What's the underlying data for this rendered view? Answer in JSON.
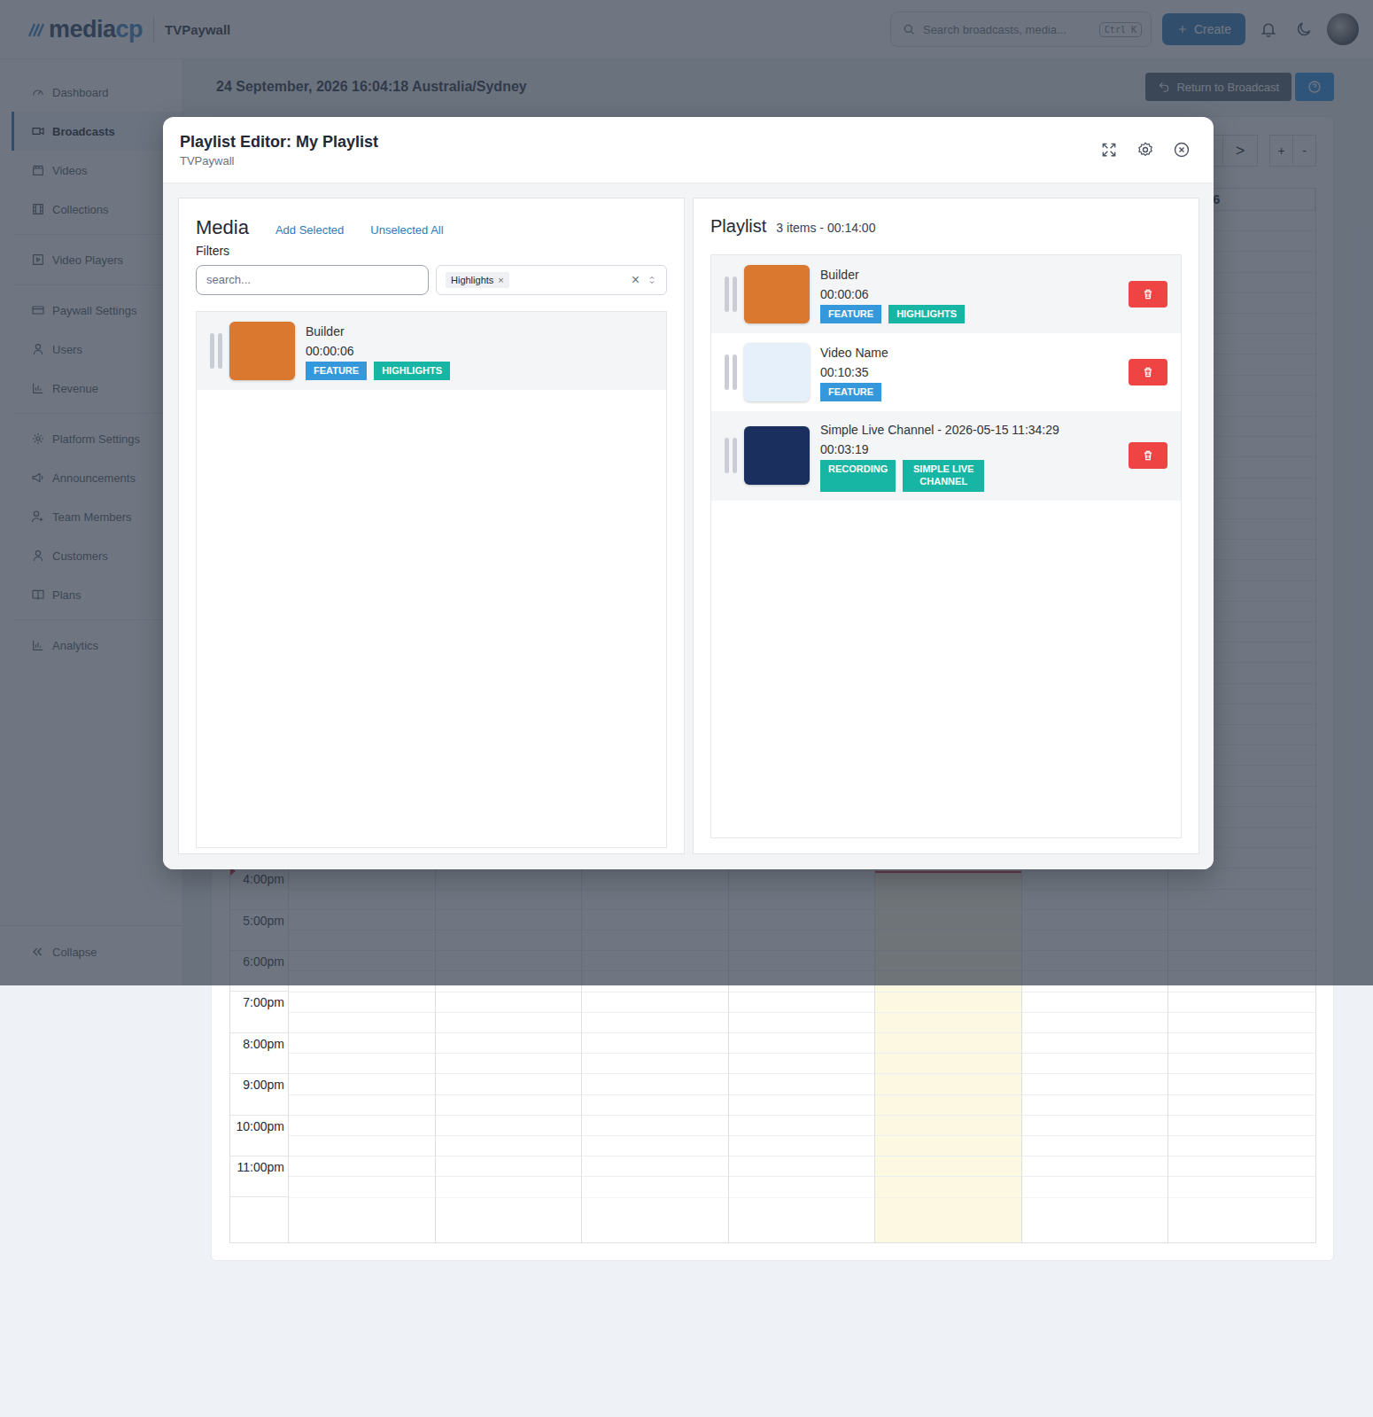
{
  "topbar": {
    "logo": [
      "media",
      "cp"
    ],
    "workspace": "TVPaywall",
    "search": {
      "placeholder": "Search broadcasts, media...",
      "shortcut": "Ctrl K"
    },
    "create_button": "Create"
  },
  "sidebar": {
    "groups": [
      [
        {
          "label": "Dashboard",
          "selected": false
        },
        {
          "label": "Broadcasts",
          "selected": true
        },
        {
          "label": "Videos",
          "selected": false
        },
        {
          "label": "Collections",
          "selected": false
        }
      ],
      [
        {
          "label": "Video Players",
          "selected": false
        }
      ],
      [
        {
          "label": "Paywall Settings",
          "selected": false
        },
        {
          "label": "Users",
          "selected": false
        },
        {
          "label": "Revenue",
          "selected": false
        }
      ],
      [
        {
          "label": "Platform Settings",
          "selected": false
        },
        {
          "label": "Announcements",
          "selected": false
        },
        {
          "label": "Team Members",
          "selected": false
        },
        {
          "label": "Customers",
          "selected": false
        },
        {
          "label": "Plans",
          "selected": false
        }
      ],
      [
        {
          "label": "Analytics",
          "selected": false
        }
      ]
    ],
    "collapse": "Collapse"
  },
  "page": {
    "datetime": "24 September, 2026 16:04:18 Australia/Sydney",
    "return_button": "Return to Broadcast"
  },
  "calendar": {
    "nav": ">",
    "zoom": [
      "+",
      "-"
    ],
    "days": [
      {
        "today": false
      },
      {
        "today": false
      },
      {
        "today": false
      },
      {
        "today": false
      },
      {
        "today": true
      },
      {
        "today": false
      },
      {
        "label": "Sat 9/26",
        "today": false
      }
    ],
    "hours": [
      "4:00pm",
      "5:00pm",
      "6:00pm",
      "7:00pm",
      "8:00pm",
      "9:00pm",
      "10:00pm",
      "11:00pm"
    ],
    "now": {
      "hour": 16,
      "minute": 4
    }
  },
  "modal": {
    "title": "Playlist Editor: My Playlist",
    "subtitle": "TVPaywall",
    "media": {
      "heading": "Media",
      "actions": [
        "Add Selected",
        "Unselected All"
      ],
      "filters_label": "Filters",
      "search_placeholder": "search...",
      "filter_tags": [
        {
          "label": "Highlights",
          "remove": "×"
        }
      ],
      "clear": "×",
      "items": [
        {
          "title": "Builder",
          "duration": "00:00:06",
          "color": "#d9782e",
          "tags": [
            {
              "label": "FEATURE",
              "color": "#3498db"
            },
            {
              "label": "HIGHLIGHTS",
              "color": "#17b5a4"
            }
          ]
        }
      ]
    },
    "playlist": {
      "heading": "Playlist",
      "summary": "3 items - 00:14:00",
      "items": [
        {
          "title": "Builder",
          "duration": "00:00:06",
          "color": "#d9782e",
          "tags": [
            {
              "label": "FEATURE",
              "color": "#3498db"
            },
            {
              "label": "HIGHLIGHTS",
              "color": "#17b5a4"
            }
          ]
        },
        {
          "title": "Video Name",
          "duration": "00:10:35",
          "color": "#e6f0fb",
          "tags": [
            {
              "label": "FEATURE",
              "color": "#3498db"
            }
          ]
        },
        {
          "title": "Simple Live Channel - 2026-05-15 11:34:29",
          "duration": "00:03:19",
          "color": "#1b2f5e",
          "tags": [
            {
              "label": "RECORDING",
              "color": "#17b5a4"
            },
            {
              "label": "SIMPLE LIVE CHANNEL",
              "color": "#17b5a4"
            }
          ]
        }
      ]
    }
  }
}
